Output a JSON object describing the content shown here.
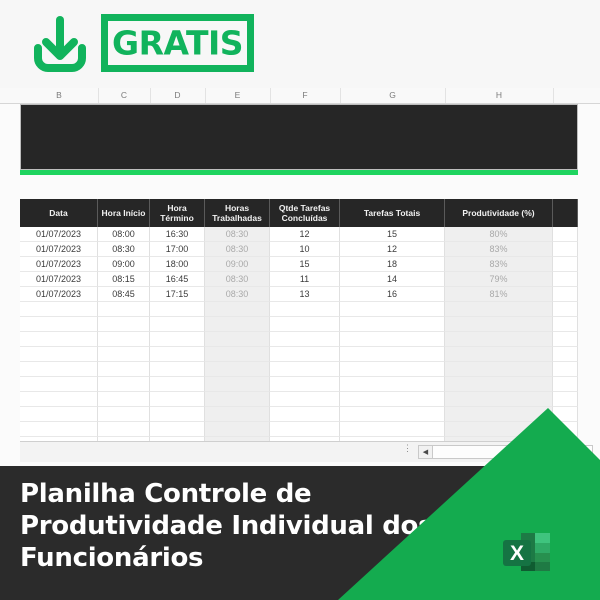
{
  "promo": {
    "download_icon": "download-icon",
    "badge_label": "GRATIS"
  },
  "spreadsheet": {
    "column_headers": [
      "B",
      "C",
      "D",
      "E",
      "F",
      "G",
      "H"
    ],
    "banner_text": "",
    "accent_stripe_color": "#1fd45f",
    "header_bg_color": "#262626",
    "table_headers": [
      "Data",
      "Hora Início",
      "Hora Término",
      "Horas Trabalhadas",
      "Qtde Tarefas Concluídas",
      "Tarefas Totais",
      "Produtividade (%)",
      ""
    ],
    "rows": [
      [
        "01/07/2023",
        "08:00",
        "16:30",
        "08:30",
        "12",
        "15",
        "80%",
        ""
      ],
      [
        "01/07/2023",
        "08:30",
        "17:00",
        "08:30",
        "10",
        "12",
        "83%",
        ""
      ],
      [
        "01/07/2023",
        "09:00",
        "18:00",
        "09:00",
        "15",
        "18",
        "83%",
        ""
      ],
      [
        "01/07/2023",
        "08:15",
        "16:45",
        "08:30",
        "11",
        "14",
        "79%",
        ""
      ],
      [
        "01/07/2023",
        "08:45",
        "17:15",
        "08:30",
        "13",
        "16",
        "81%",
        ""
      ]
    ],
    "empty_row_count": 10,
    "scrollbar": {
      "split_handle": "⋮",
      "left_arrow": "◀"
    }
  },
  "footer": {
    "title": "Planilha Controle de Produtividade Individual dos Funcionários",
    "logo_letter": "X",
    "brand_color": "#14ab4f"
  }
}
